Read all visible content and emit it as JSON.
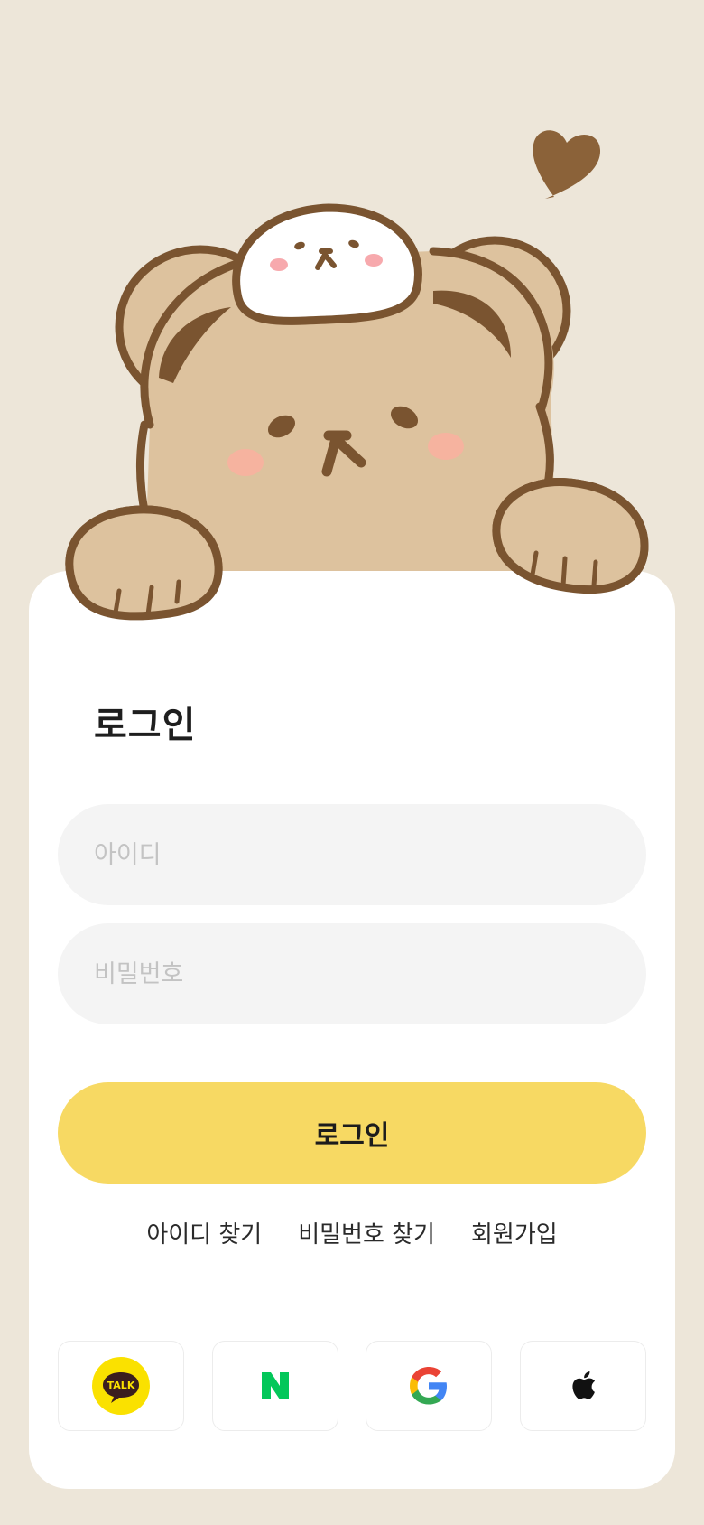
{
  "login": {
    "title": "로그인",
    "id_placeholder": "아이디",
    "password_placeholder": "비밀번호",
    "submit_label": "로그인"
  },
  "links": {
    "find_id": "아이디 찾기",
    "find_password": "비밀번호 찾기",
    "signup": "회원가입"
  },
  "social": {
    "kakao_label": "TALK",
    "kakao_icon": "kakao-talk-icon",
    "naver_icon": "naver-icon",
    "google_icon": "google-icon",
    "apple_icon": "apple-icon"
  },
  "colors": {
    "background": "#ede6d9",
    "accent": "#f7d963",
    "bear_fur": "#ddc29e",
    "bear_outline": "#7a5430"
  }
}
